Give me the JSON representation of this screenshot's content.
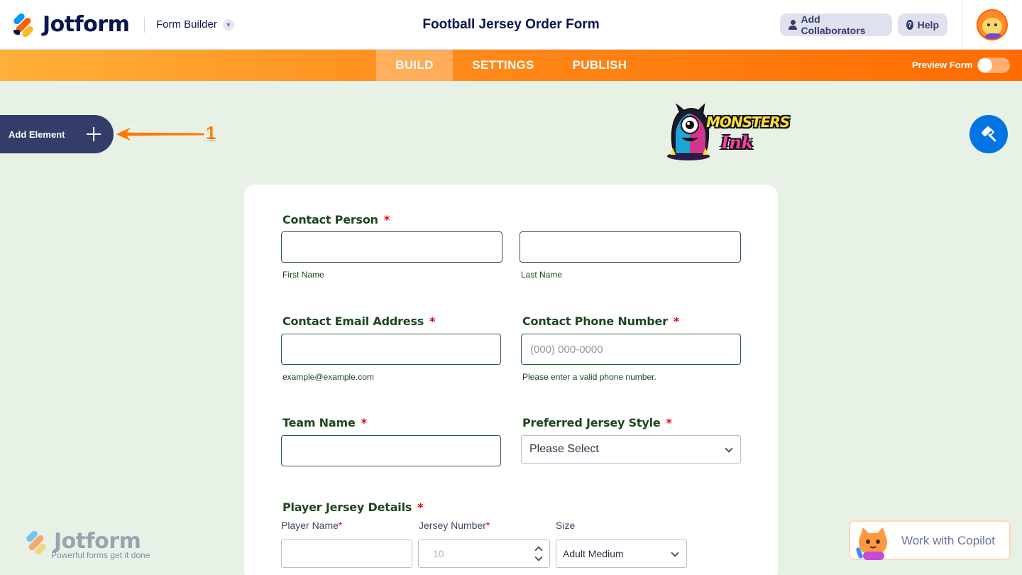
{
  "header": {
    "logo_text": "Jotform",
    "app_menu_label": "Form Builder",
    "form_title": "Football Jersey Order Form",
    "collaborators_label": "Add Collaborators",
    "help_label": "Help"
  },
  "nav": {
    "tabs": [
      {
        "label": "BUILD",
        "active": true
      },
      {
        "label": "SETTINGS",
        "active": false
      },
      {
        "label": "PUBLISH",
        "active": false
      }
    ],
    "preview_label": "Preview Form",
    "preview_on": false
  },
  "sidebar": {
    "add_element_label": "Add Element"
  },
  "annotation": {
    "number": "1",
    "color": "#ff7a00"
  },
  "brand": {
    "line1": "MONSTERS",
    "line2": "Ink"
  },
  "form": {
    "contact_person": {
      "label": "Contact Person",
      "required": "*",
      "first_sublabel": "First Name",
      "last_sublabel": "Last Name"
    },
    "email": {
      "label": "Contact Email Address",
      "required": "*",
      "sublabel": "example@example.com"
    },
    "phone": {
      "label": "Contact Phone Number",
      "required": "*",
      "placeholder": "(000) 000-0000",
      "sublabel": "Please enter a valid phone number."
    },
    "team": {
      "label": "Team Name",
      "required": "*"
    },
    "jersey_style": {
      "label": "Preferred Jersey Style",
      "required": "*",
      "selected": "Please Select"
    },
    "player_details": {
      "label": "Player Jersey Details",
      "required": "*",
      "columns": [
        {
          "label": "Player Name",
          "required": "*"
        },
        {
          "label": "Jersey Number",
          "required": "*"
        },
        {
          "label": "Size",
          "required": ""
        }
      ],
      "row": {
        "player_name": "",
        "jersey_number_placeholder": "10",
        "size": "Adult Medium"
      }
    }
  },
  "watermark": {
    "logo_text": "Jotform",
    "tagline": "Powerful forms get it done"
  },
  "copilot": {
    "label": "Work with Copilot"
  },
  "colors": {
    "brand_dark": "#0a1551",
    "accent_orange": "#ff6100",
    "form_label_green": "#1e4620",
    "page_bg": "#e8f1e6",
    "designer_blue": "#0075e3"
  }
}
